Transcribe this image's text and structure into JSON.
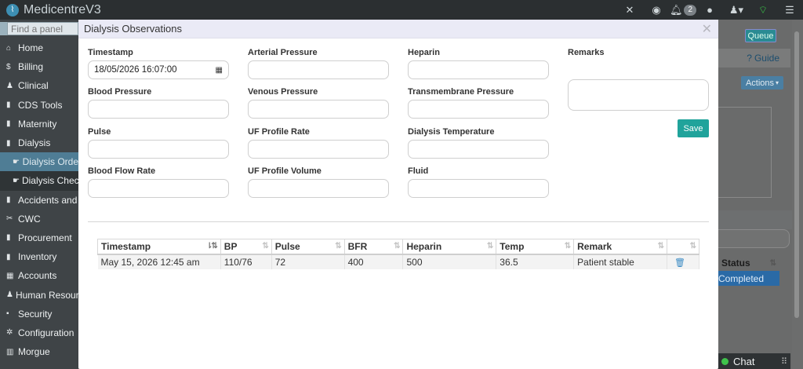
{
  "app": {
    "title": "MedicentreV3",
    "notifications_count": "2"
  },
  "sidebar": {
    "search_placeholder": "Find a panel",
    "items": [
      {
        "label": "Home",
        "icon": "home-icon",
        "glyph": "⌂"
      },
      {
        "label": "Billing",
        "icon": "dollar-icon",
        "glyph": "$"
      },
      {
        "label": "Clinical",
        "icon": "user-icon",
        "glyph": "♟"
      },
      {
        "label": "CDS Tools",
        "icon": "file-icon",
        "glyph": "▮"
      },
      {
        "label": "Maternity",
        "icon": "file-icon",
        "glyph": "▮"
      },
      {
        "label": "Dialysis",
        "icon": "file-icon",
        "glyph": "▮"
      },
      {
        "label": "Dialysis Orde",
        "icon": "hand-icon",
        "glyph": "☛"
      },
      {
        "label": "Dialysis Chec",
        "icon": "hand-icon",
        "glyph": "☛"
      },
      {
        "label": "Accidents and",
        "icon": "file-icon",
        "glyph": "▮"
      },
      {
        "label": "CWC",
        "icon": "tools-icon",
        "glyph": "✂"
      },
      {
        "label": "Procurement",
        "icon": "file-icon",
        "glyph": "▮"
      },
      {
        "label": "Inventory",
        "icon": "file-icon",
        "glyph": "▮"
      },
      {
        "label": "Accounts",
        "icon": "calculator-icon",
        "glyph": "▦"
      },
      {
        "label": "Human Resour",
        "icon": "users-icon",
        "glyph": "♟"
      },
      {
        "label": "Security",
        "icon": "lock-icon",
        "glyph": "▪"
      },
      {
        "label": "Configuration",
        "icon": "gears-icon",
        "glyph": "✲"
      },
      {
        "label": "Morgue",
        "icon": "building-icon",
        "glyph": "▥"
      }
    ]
  },
  "background": {
    "queue_label": "Queue",
    "guide_label": "Guide",
    "actions_label": "Actions",
    "status_header": "Status",
    "status_value": "Completed",
    "chat_label": "Chat"
  },
  "modal": {
    "title": "Dialysis Observations",
    "fields": {
      "timestamp": {
        "label": "Timestamp",
        "value": "18/05/2026 16:07:00"
      },
      "arterial_pressure": {
        "label": "Arterial Pressure",
        "value": ""
      },
      "heparin": {
        "label": "Heparin",
        "value": ""
      },
      "remarks": {
        "label": "Remarks",
        "value": ""
      },
      "blood_pressure": {
        "label": "Blood Pressure",
        "value": ""
      },
      "venous_pressure": {
        "label": "Venous Pressure",
        "value": ""
      },
      "transmembrane_pressure": {
        "label": "Transmembrane Pressure",
        "value": ""
      },
      "pulse": {
        "label": "Pulse",
        "value": ""
      },
      "uf_profile_rate": {
        "label": "UF Profile Rate",
        "value": ""
      },
      "dialysis_temperature": {
        "label": "Dialysis Temperature",
        "value": ""
      },
      "blood_flow_rate": {
        "label": "Blood Flow Rate",
        "value": ""
      },
      "uf_profile_volume": {
        "label": "UF Profile Volume",
        "value": ""
      },
      "fluid": {
        "label": "Fluid",
        "value": ""
      }
    },
    "save_label": "Save",
    "table": {
      "headers": [
        "Timestamp",
        "BP",
        "Pulse",
        "BFR",
        "Heparin",
        "Temp",
        "Remark",
        ""
      ],
      "rows": [
        [
          "May 15, 2026 12:45 am",
          "110/76",
          "72",
          "400",
          "500",
          "36.5",
          "Patient stable"
        ]
      ]
    }
  }
}
